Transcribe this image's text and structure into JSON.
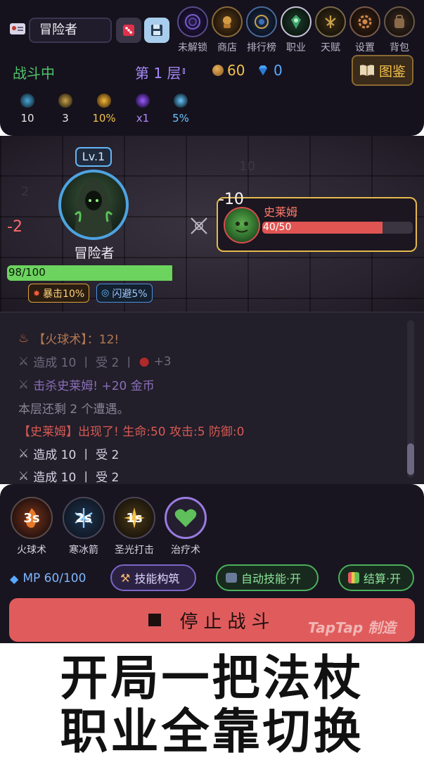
{
  "profile": {
    "name": "冒险者"
  },
  "nav": [
    {
      "label": "未解锁",
      "icon": "locked-orb-icon",
      "color": "#6a4fc0"
    },
    {
      "label": "商店",
      "icon": "shop-icon",
      "color": "#b8822e"
    },
    {
      "label": "排行榜",
      "icon": "leaderboard-icon",
      "color": "#3f6fb5"
    },
    {
      "label": "职业",
      "icon": "class-icon",
      "color": "#3fa36a"
    },
    {
      "label": "天赋",
      "icon": "talent-icon",
      "color": "#a07a3a"
    },
    {
      "label": "设置",
      "icon": "settings-icon",
      "color": "#b06a3a"
    },
    {
      "label": "背包",
      "icon": "backpack-icon",
      "color": "#8a6a4a"
    }
  ],
  "status": {
    "state": "战斗中",
    "floor": "第 1 层",
    "gold": "60",
    "gems": "0"
  },
  "codex_label": "图鉴",
  "stats": [
    {
      "value": "10",
      "icon": "attack-icon",
      "color": "#e6e6e6",
      "icon_color": "#4aa8d8"
    },
    {
      "value": "3",
      "icon": "defense-icon",
      "color": "#e6e6e6",
      "icon_color": "#c9a24a"
    },
    {
      "value": "10%",
      "icon": "crit-icon",
      "color": "#f3c14b",
      "icon_color": "#f3b73b"
    },
    {
      "value": "x1",
      "icon": "multiplier-icon",
      "color": "#b78bff",
      "icon_color": "#9b5cff"
    },
    {
      "value": "5%",
      "icon": "dodge-icon",
      "color": "#6cc6ff",
      "icon_color": "#6cc6ff"
    }
  ],
  "hero": {
    "level": "Lv.1",
    "name": "冒险者",
    "damage_taken": "-2",
    "hp_text": "98/100",
    "hp_fraction": 0.98
  },
  "buffs": [
    {
      "label": "暴击10%",
      "icon": "crit-spark-icon"
    },
    {
      "label": "闪避5%",
      "icon": "dodge-swirl-icon"
    }
  ],
  "enemy": {
    "name": "史莱姆",
    "hp_text": "40/50",
    "hp_fraction": 0.8,
    "damage_taken": "-10"
  },
  "log": [
    {
      "text": "【火球术】：12!",
      "color": "#b37a52",
      "icon": "fire-icon"
    },
    {
      "text": "造成 10 丨 受 2 丨",
      "extra": "+3",
      "color": "#6f6a7c",
      "icon": "swords-icon"
    },
    {
      "text": "击杀史莱姆! +20 金币",
      "color": "#8a6fb8",
      "icon": "swords-icon"
    },
    {
      "text": "本层还剩 2 个遭遇。",
      "color": "#8a8596",
      "icon": ""
    },
    {
      "text": "【史莱姆】出现了! 生命:50 攻击:5 防御:0",
      "color": "#d65a52",
      "icon": ""
    },
    {
      "text": "造成 10 丨 受 2",
      "color": "#d8d4e4",
      "icon": "swords-icon"
    },
    {
      "text": "造成 10 丨 受 2",
      "color": "#d8d4e4",
      "icon": "swords-icon"
    }
  ],
  "skills": [
    {
      "label": "火球术",
      "cooldown": "3s",
      "icon": "fireball-icon"
    },
    {
      "label": "寒冰箭",
      "cooldown": "2s",
      "icon": "frost-arrow-icon"
    },
    {
      "label": "圣光打击",
      "cooldown": "1s",
      "icon": "holy-strike-icon"
    },
    {
      "label": "治疗术",
      "cooldown": "",
      "icon": "heal-heart-icon"
    }
  ],
  "mp": "MP 60/100",
  "buttons": {
    "build": "技能构筑",
    "auto": "自动技能·开",
    "settle": "结算·开",
    "stop": "停止战斗"
  },
  "watermark": "TapTap 制造",
  "caption": [
    "开局一把法杖",
    "职业全靠切换"
  ]
}
